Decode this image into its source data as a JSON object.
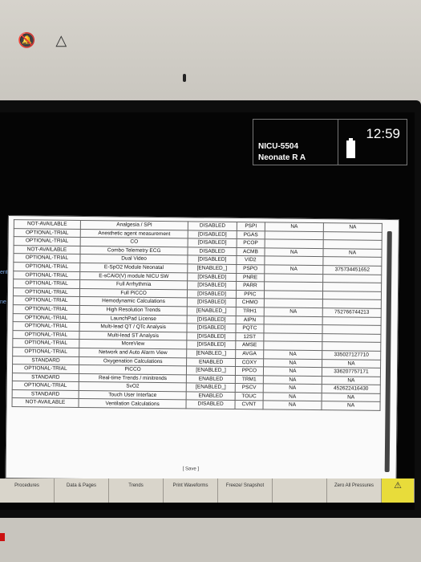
{
  "bezel": {
    "icons": "🔕 △"
  },
  "header": {
    "patient_id": "NICU-5504",
    "patient_name": "Neonate R A",
    "time": "12:59"
  },
  "side_labels": {
    "a": "ent",
    "b": "ne"
  },
  "table": {
    "rows": [
      [
        "NOT-AVAILABLE",
        "Analgesia / SPI",
        "DISABLED",
        "PSPI",
        "NA",
        "NA"
      ],
      [
        "OPTIONAL-TRIAL",
        "Anesthetic agent measurement",
        "[DISABLED]",
        "PGAS",
        "",
        ""
      ],
      [
        "OPTIONAL-TRIAL",
        "CO",
        "[DISABLED]",
        "PCOP",
        "",
        ""
      ],
      [
        "NOT-AVAILABLE",
        "Combo Telemetry ECG",
        "DISABLED",
        "ACMB",
        "NA",
        "NA"
      ],
      [
        "OPTIONAL-TRIAL",
        "Dual Video",
        "[DISABLED]",
        "VID2",
        "",
        ""
      ],
      [
        "OPTIONAL-TRIAL",
        "E-SpO2 Module Neonatal",
        "[ENABLED_]",
        "PSPO",
        "NA",
        "375734451652"
      ],
      [
        "OPTIONAL-TRIAL",
        "E-sCAiO(V) module NICU SW",
        "[DISABLED]",
        "PNRE",
        "",
        ""
      ],
      [
        "OPTIONAL-TRIAL",
        "Full Arrhythmia",
        "[DISABLED]",
        "PARR",
        "",
        ""
      ],
      [
        "OPTIONAL-TRIAL",
        "Full PiCCO",
        "[DISABLED]",
        "PPIC",
        "",
        ""
      ],
      [
        "OPTIONAL-TRIAL",
        "Hemodynamic Calculations",
        "[DISABLED]",
        "CHMO",
        "",
        ""
      ],
      [
        "OPTIONAL-TRIAL",
        "High Resolution Trends",
        "[ENABLED_]",
        "TRH1",
        "NA",
        "752766744213"
      ],
      [
        "OPTIONAL-TRIAL",
        "LaunchPad License",
        "[DISABLED]",
        "AIPN",
        "",
        ""
      ],
      [
        "OPTIONAL-TRIAL",
        "Multi-lead QT / QTc Analysis",
        "[DISABLED]",
        "PQTC",
        "",
        ""
      ],
      [
        "OPTIONAL-TRIAL",
        "Multi-lead ST Analysis",
        "[DISABLED]",
        "12ST",
        "",
        ""
      ],
      [
        "OPTIONAL-TRIAL",
        "MoreView",
        "[DISABLED]",
        "AMSE",
        "",
        ""
      ],
      [
        "OPTIONAL-TRIAL",
        "Network and Auto Alarm View",
        "[ENABLED_]",
        "AVGA",
        "NA",
        "335027127710"
      ],
      [
        "STANDARD",
        "Oxygenation Calculations",
        "ENABLED",
        "COXY",
        "NA",
        "NA"
      ],
      [
        "OPTIONAL-TRIAL",
        "PiCCO",
        "[ENABLED_]",
        "PPCO",
        "NA",
        "336207757171"
      ],
      [
        "STANDARD",
        "Real-time Trends / minitrends",
        "ENABLED",
        "TRM1",
        "NA",
        "NA"
      ],
      [
        "OPTIONAL-TRIAL",
        "SvO2",
        "[ENABLED_]",
        "PSCV",
        "NA",
        "452622416430"
      ],
      [
        "STANDARD",
        "Touch User Interface",
        "ENABLED",
        "TOUC",
        "NA",
        "NA"
      ],
      [
        "NOT-AVAILABLE",
        "Ventilation Calculations",
        "DISABLED",
        "CVNT",
        "NA",
        "NA"
      ]
    ],
    "save_label": "[ Save ]"
  },
  "bottombar": {
    "buttons": [
      "Procedures",
      "Data & Pages",
      "Trends",
      "Print Waveforms",
      "Freeze/ Snapshot",
      "",
      "Zero All Pressures"
    ],
    "alarm_icon": "⚠"
  }
}
